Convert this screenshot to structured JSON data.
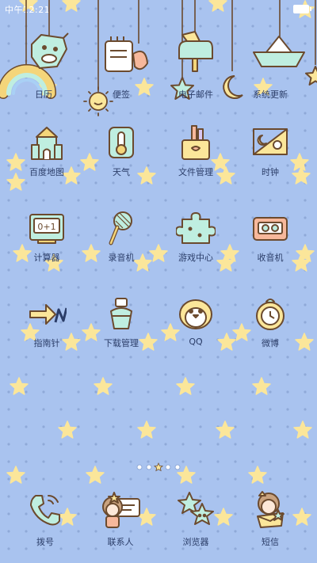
{
  "status_bar": {
    "time": "中午12:21"
  },
  "hanging_row": [
    {
      "label": "日历",
      "icon": "calendar-cow-icon"
    },
    {
      "label": "便签",
      "icon": "notepad-icon"
    },
    {
      "label": "电子邮件",
      "icon": "mailbox-icon"
    },
    {
      "label": "系统更新",
      "icon": "paper-boat-icon"
    }
  ],
  "apps": [
    {
      "label": "百度地图",
      "icon": "castle-icon"
    },
    {
      "label": "天气",
      "icon": "thermometer-icon"
    },
    {
      "label": "文件管理",
      "icon": "file-box-icon"
    },
    {
      "label": "时钟",
      "icon": "day-night-icon"
    },
    {
      "label": "计算器",
      "icon": "calculator-icon"
    },
    {
      "label": "录音机",
      "icon": "microphone-icon"
    },
    {
      "label": "游戏中心",
      "icon": "puzzle-icon"
    },
    {
      "label": "收音机",
      "icon": "radio-icon"
    },
    {
      "label": "指南针",
      "icon": "arrow-n-icon"
    },
    {
      "label": "下载管理",
      "icon": "bottle-icon"
    },
    {
      "label": "QQ",
      "icon": "penguin-icon"
    },
    {
      "label": "微博",
      "icon": "ring-icon"
    }
  ],
  "page_indicator": {
    "count": 5,
    "active": 2
  },
  "dock": [
    {
      "label": "拨号",
      "icon": "phone-icon"
    },
    {
      "label": "联系人",
      "icon": "contact-card-icon"
    },
    {
      "label": "浏览器",
      "icon": "stars-icon"
    },
    {
      "label": "短信",
      "icon": "girl-letter-icon"
    }
  ],
  "colors": {
    "background": "#a9c3ef",
    "star": "#fbe69a",
    "outline": "#6b4a2e",
    "mint": "#bfeee0",
    "label": "#2b3d68"
  }
}
